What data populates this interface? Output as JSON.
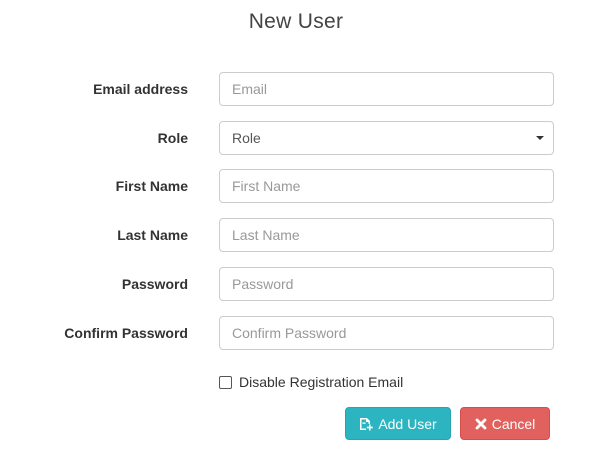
{
  "page": {
    "title": "New User"
  },
  "form": {
    "email": {
      "label": "Email address",
      "placeholder": "Email",
      "value": ""
    },
    "role": {
      "label": "Role",
      "selected": "Role"
    },
    "first_name": {
      "label": "First Name",
      "placeholder": "First Name",
      "value": ""
    },
    "last_name": {
      "label": "Last Name",
      "placeholder": "Last Name",
      "value": ""
    },
    "password": {
      "label": "Password",
      "placeholder": "Password",
      "value": ""
    },
    "confirm_password": {
      "label": "Confirm Password",
      "placeholder": "Confirm Password",
      "value": ""
    },
    "disable_email": {
      "label": "Disable Registration Email",
      "checked": false
    }
  },
  "buttons": {
    "add_user": {
      "label": "Add User",
      "icon": "add-user-icon",
      "color": "#2cb5c1"
    },
    "cancel": {
      "label": "Cancel",
      "icon": "close-icon",
      "color": "#e0615e"
    }
  }
}
